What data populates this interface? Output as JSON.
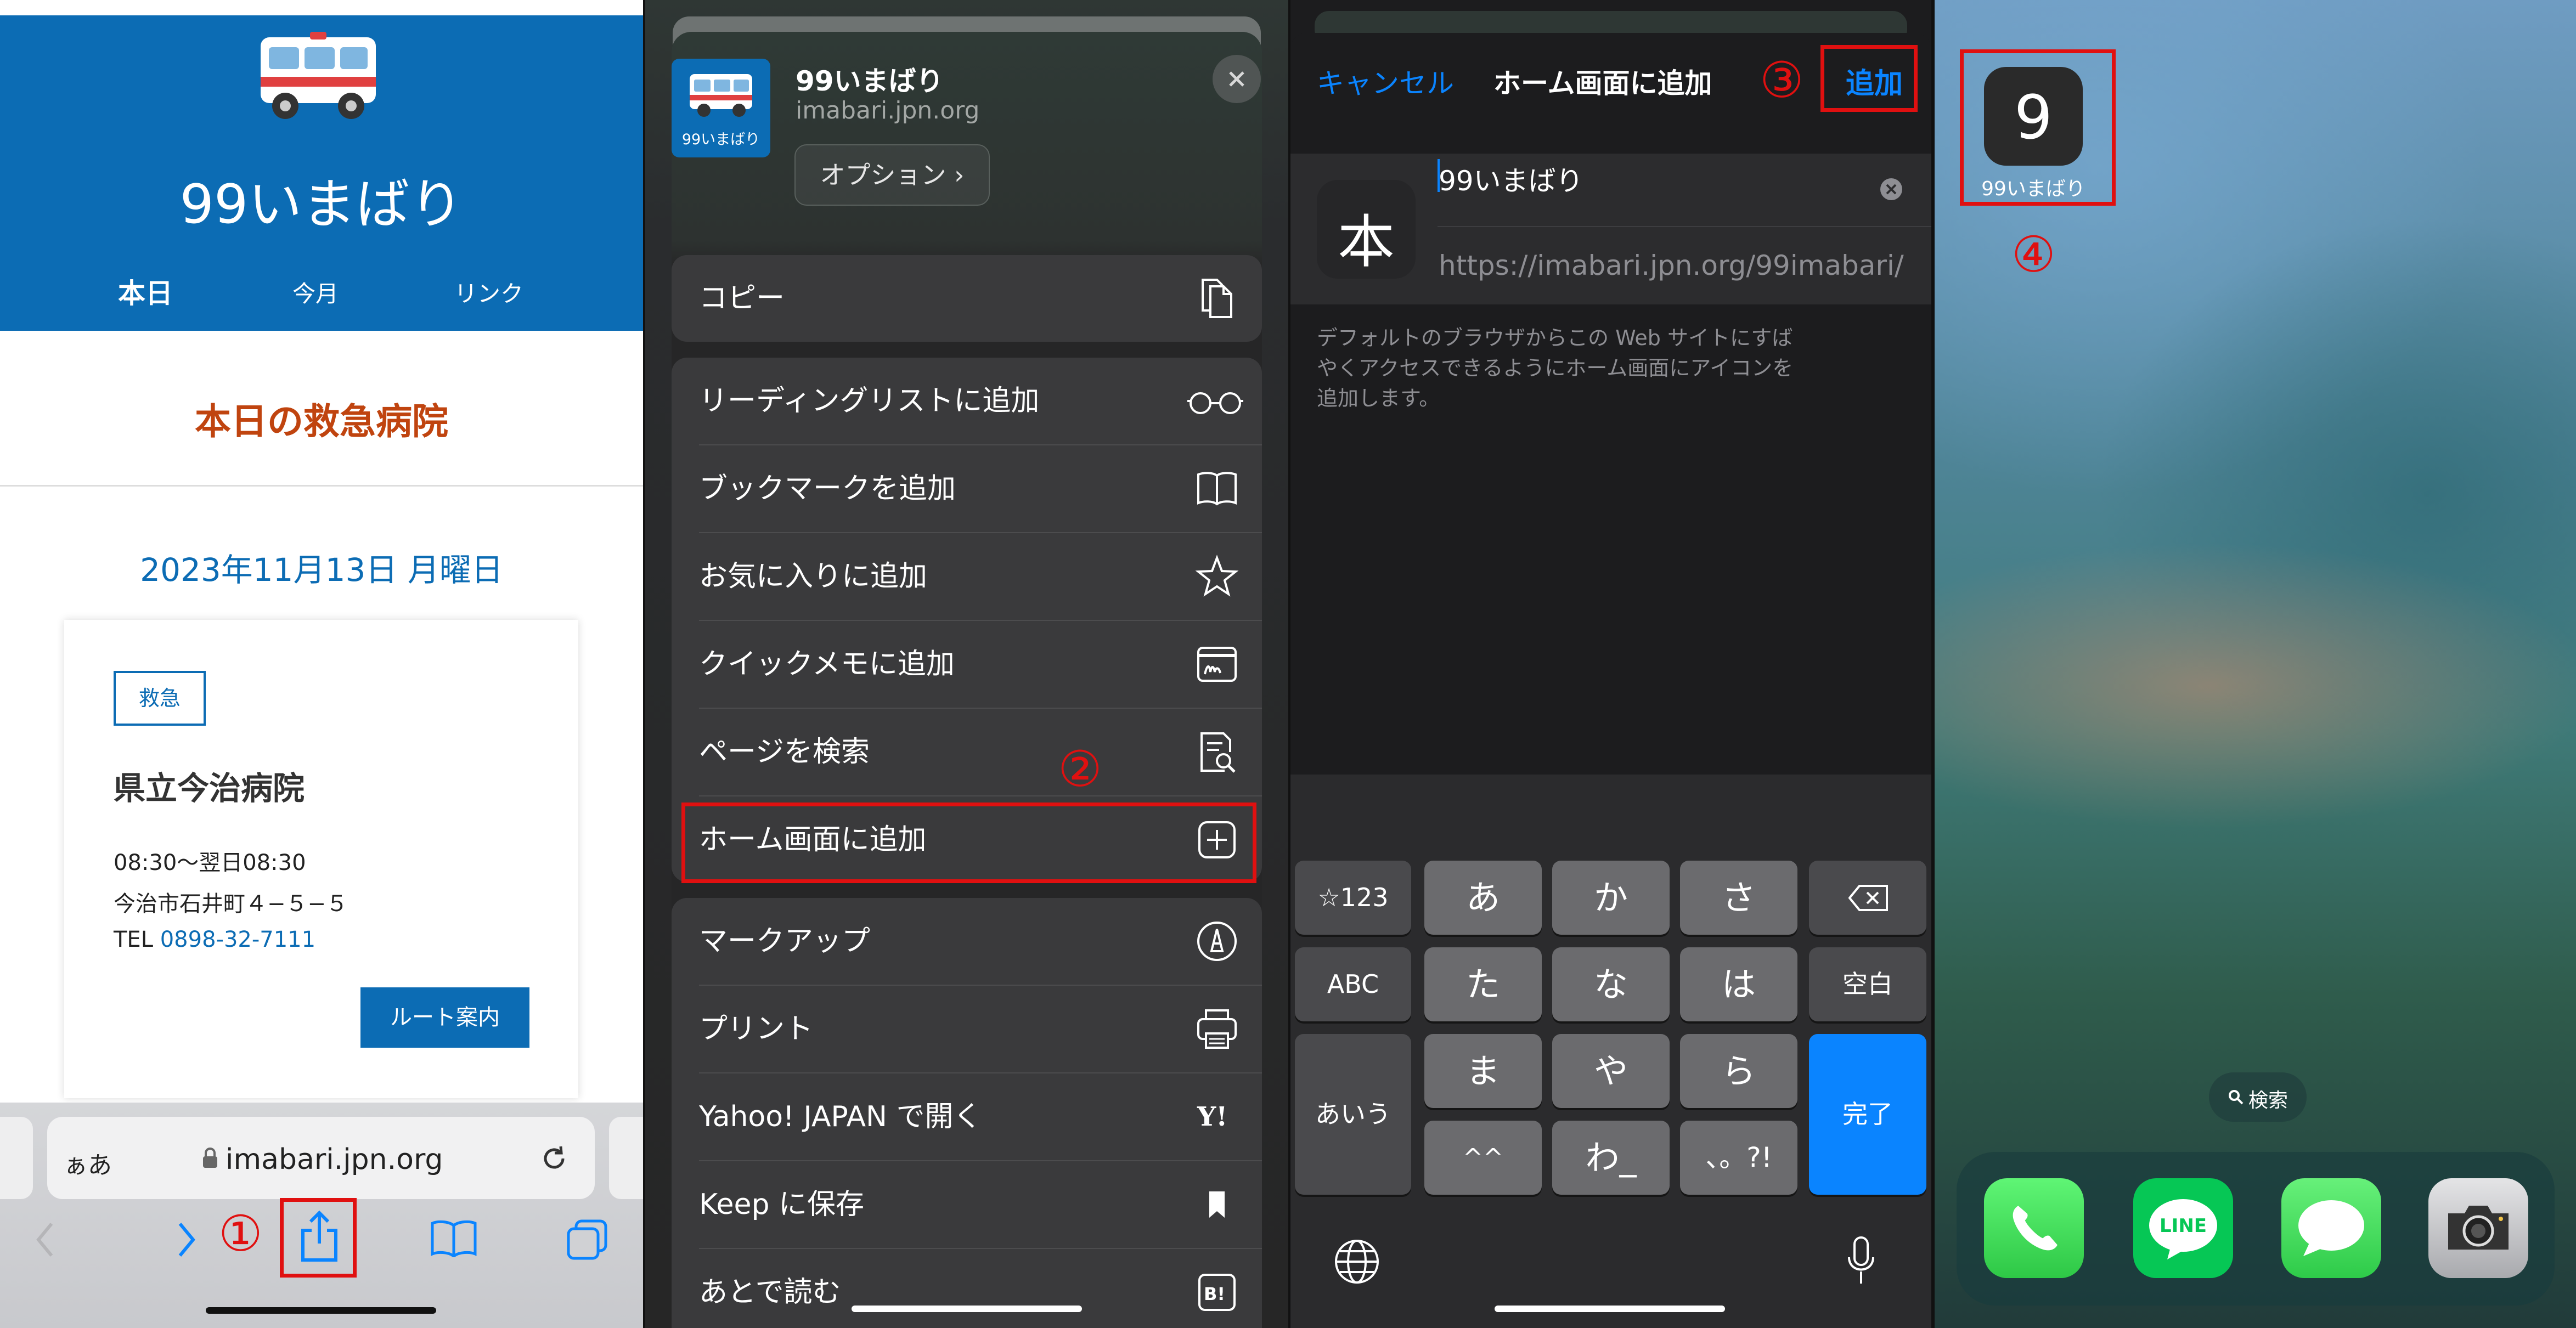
{
  "pane1": {
    "site_title": "99いまばり",
    "nav": [
      "本日",
      "今月",
      "リンク"
    ],
    "section_title": "本日の救急病院",
    "date": "2023年11月13日 月曜日",
    "card": {
      "badge": "救急",
      "hospital": "県立今治病院",
      "hours": "08:30〜翌日08:30",
      "address": "今治市石井町４−５−５",
      "tel_label": "TEL ",
      "tel": "0898-32-7111",
      "route_button": "ルート案内"
    },
    "address_bar": {
      "aa": "ぁあ",
      "url": "imabari.jpn.org"
    },
    "step": "①"
  },
  "pane2": {
    "site_name": "99いまばり",
    "site_url": "imabari.jpn.org",
    "thumb_label": "99いまばり",
    "options_label": "オプション ›",
    "groups": [
      [
        {
          "label": "コピー",
          "icon": "copy-icon"
        }
      ],
      [
        {
          "label": "リーディングリストに追加",
          "icon": "glasses-icon"
        },
        {
          "label": "ブックマークを追加",
          "icon": "book-icon"
        },
        {
          "label": "お気に入りに追加",
          "icon": "star-icon"
        },
        {
          "label": "クイックメモに追加",
          "icon": "quick-note-icon"
        },
        {
          "label": "ページを検索",
          "icon": "find-page-icon"
        },
        {
          "label": "ホーム画面に追加",
          "icon": "add-square-icon"
        }
      ],
      [
        {
          "label": "マークアップ",
          "icon": "markup-icon"
        },
        {
          "label": "プリント",
          "icon": "printer-icon"
        },
        {
          "label": "Yahoo! JAPAN で開く",
          "icon": "yahoo-icon"
        },
        {
          "label": "Keep に保存",
          "icon": "bookmark-flag-icon"
        },
        {
          "label": "あとで読む",
          "icon": "hatena-icon"
        }
      ]
    ],
    "step": "②"
  },
  "pane3": {
    "cancel": "キャンセル",
    "title": "ホーム画面に追加",
    "add": "追加",
    "icon_char": "本",
    "name_value": "99いまばり",
    "url": "https://imabari.jpn.org/99imabari/",
    "description": [
      "デフォルトのブラウザからこの Web サイトにすば",
      "やくアクセスできるようにホーム画面にアイコンを",
      "追加します。"
    ],
    "keys": {
      "sym": "☆123",
      "abc": "ABC",
      "aiu": "あいう",
      "space": "空白",
      "done": "完了",
      "row1": [
        "あ",
        "か",
        "さ"
      ],
      "row2": [
        "た",
        "な",
        "は"
      ],
      "row3": [
        "ま",
        "や",
        "ら"
      ],
      "row4": [
        "^^",
        "わ_",
        "、。?!"
      ]
    },
    "step": "③"
  },
  "pane4": {
    "app_glyph": "9",
    "app_label": "99いまばり",
    "search_pill": "検索",
    "step": "④",
    "dock": [
      "phone-icon",
      "line-app-icon",
      "messages-icon",
      "camera-icon"
    ],
    "line_text": "LINE"
  },
  "colors": {
    "accent_blue": "#0c6cb4",
    "ios_blue": "#0a84ff",
    "highlight_red": "#e01010",
    "section_orange": "#c0440f"
  }
}
